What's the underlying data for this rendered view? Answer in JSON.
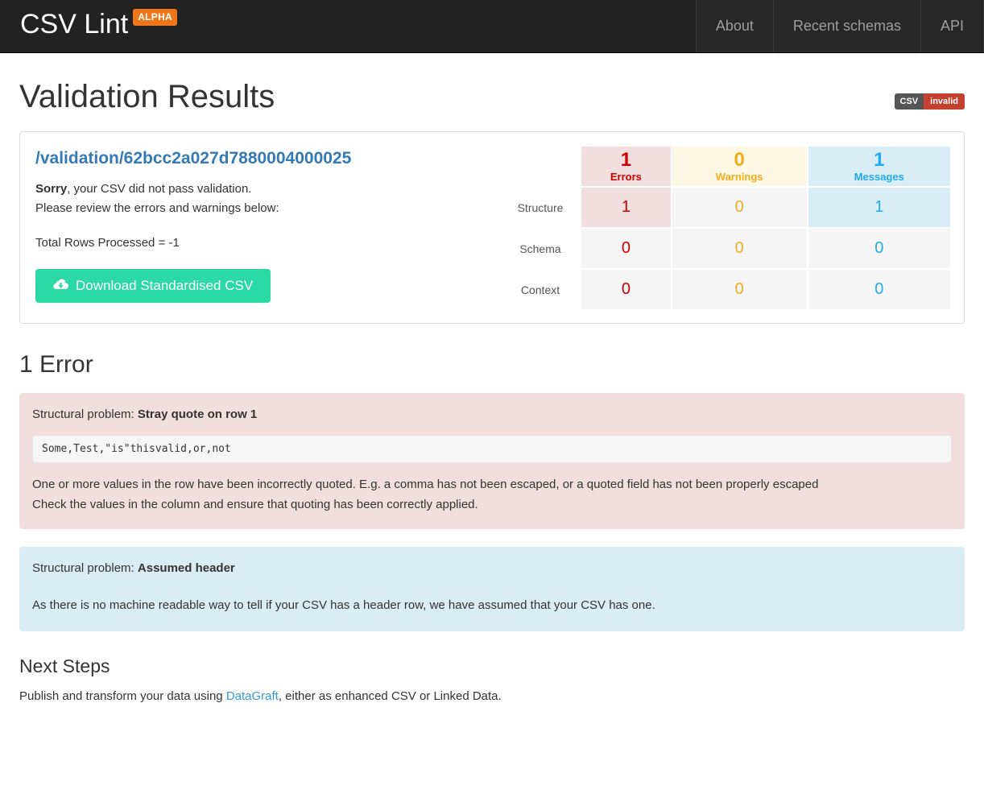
{
  "navbar": {
    "brand": "CSV Lint",
    "brand_badge": "ALPHA",
    "links": [
      {
        "label": "About"
      },
      {
        "label": "Recent schemas"
      },
      {
        "label": "API"
      }
    ]
  },
  "page": {
    "title": "Validation Results",
    "status_badge": {
      "left": "CSV",
      "right": "invalid"
    }
  },
  "result": {
    "url": "/validation/62bcc2a027d7880004000025",
    "summary_bold": "Sorry",
    "summary_rest": ", your CSV did not pass validation.",
    "summary_line2": "Please review the errors and warnings below:",
    "rows_processed": "Total Rows Processed = -1",
    "download_label": "Download Standardised CSV"
  },
  "summary_table": {
    "columns": [
      {
        "label": "Errors",
        "count": "1"
      },
      {
        "label": "Warnings",
        "count": "0"
      },
      {
        "label": "Messages",
        "count": "1"
      }
    ],
    "rows": [
      {
        "label": "Structure",
        "errors": "1",
        "warnings": "0",
        "messages": "1"
      },
      {
        "label": "Schema",
        "errors": "0",
        "warnings": "0",
        "messages": "0"
      },
      {
        "label": "Context",
        "errors": "0",
        "warnings": "0",
        "messages": "0"
      }
    ]
  },
  "errors_section": {
    "title": "1 Error",
    "alerts": [
      {
        "prefix": "Structural problem: ",
        "name": "Stray quote on row 1",
        "code": "Some,Test,\"is\"thisvalid,or,not",
        "body_line1": "One or more values in the row have been incorrectly quoted. E.g. a comma has not been escaped, or a quoted field has not been properly escaped",
        "body_line2": "Check the values in the column and ensure that quoting has been correctly applied."
      },
      {
        "prefix": "Structural problem: ",
        "name": "Assumed header",
        "body_line1": "As there is no machine readable way to tell if your CSV has a header row, we have assumed that your CSV has one."
      }
    ]
  },
  "next_steps": {
    "title": "Next Steps",
    "text_before": "Publish and transform your data using ",
    "link": "DataGraft",
    "text_after": ", either as enhanced CSV or Linked Data."
  },
  "colors": {
    "error": "#cc0000",
    "warning": "#f0ad1f",
    "message": "#22aaf0",
    "brand_badge": "#f0761a",
    "download_button": "#2bd9a4",
    "link": "#337ab7"
  }
}
